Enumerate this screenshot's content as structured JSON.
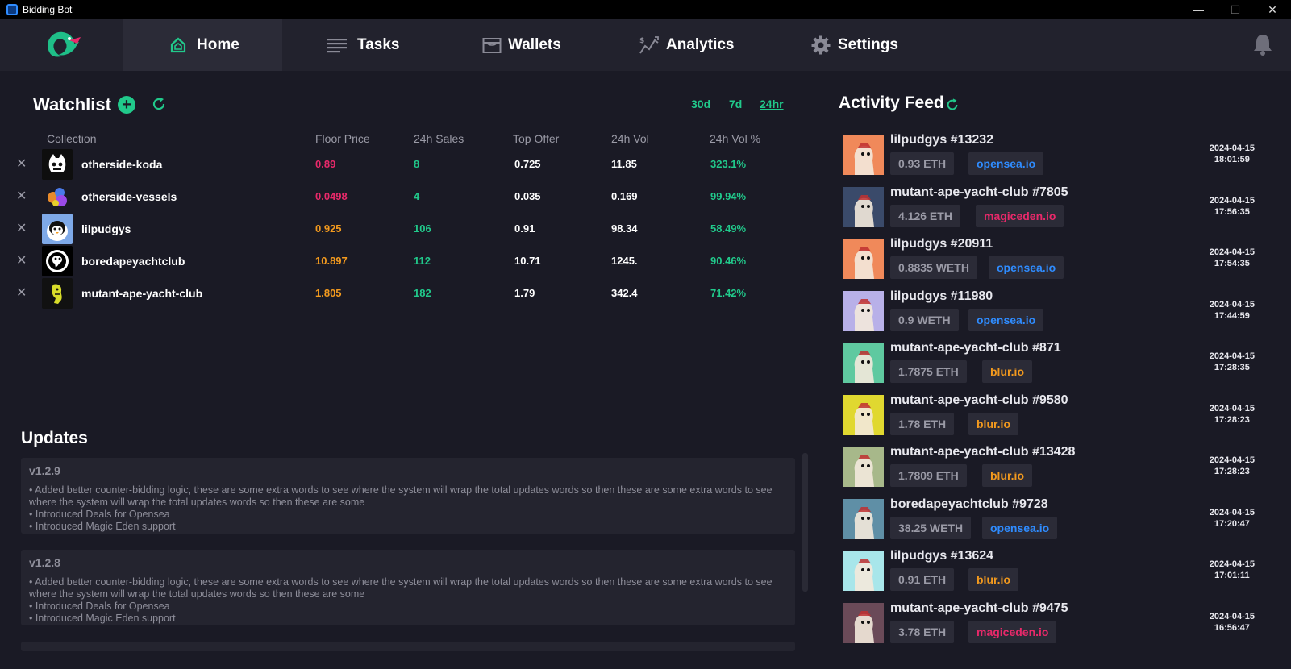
{
  "window": {
    "title": "Bidding Bot",
    "controls": [
      "—",
      "☐",
      "✕"
    ]
  },
  "nav": {
    "items": [
      {
        "label": "Home",
        "icon": "home-icon",
        "active": true
      },
      {
        "label": "Tasks",
        "icon": "list-icon"
      },
      {
        "label": "Wallets",
        "icon": "wallet-icon"
      },
      {
        "label": "Analytics",
        "icon": "analytics-icon"
      },
      {
        "label": "Settings",
        "icon": "gear-icon"
      }
    ],
    "notification_icon": "bell-icon"
  },
  "watchlist": {
    "title": "Watchlist",
    "add_label": "+",
    "ranges": [
      "30d",
      "7d",
      "24hr"
    ],
    "selected_range": "24hr",
    "columns": [
      "Collection",
      "Floor Price",
      "24h Sales",
      "Top Offer",
      "24h Vol",
      "24h Vol %"
    ],
    "remove_label": "✕",
    "rows": [
      {
        "name": "otherside-koda",
        "floor": "0.89",
        "sales": "8",
        "offer": "0.725",
        "vol": "11.85",
        "vol_pct": "323.1%",
        "floor_color": "#e8296a",
        "thumb": "koda"
      },
      {
        "name": "otherside-vessels",
        "floor": "0.0498",
        "sales": "4",
        "offer": "0.035",
        "vol": "0.169",
        "vol_pct": "99.94%",
        "floor_color": "#e8296a",
        "thumb": "vessels"
      },
      {
        "name": "lilpudgys",
        "floor": "0.925",
        "sales": "106",
        "offer": "0.91",
        "vol": "98.34",
        "vol_pct": "58.49%",
        "floor_color": "#f39a1e",
        "thumb": "pudgy"
      },
      {
        "name": "boredapeyachtclub",
        "floor": "10.897",
        "sales": "112",
        "offer": "10.71",
        "vol": "1245.",
        "vol_pct": "90.46%",
        "floor_color": "#f39a1e",
        "thumb": "bayc"
      },
      {
        "name": "mutant-ape-yacht-club",
        "floor": "1.805",
        "sales": "182",
        "offer": "1.79",
        "vol": "342.4",
        "vol_pct": "71.42%",
        "floor_color": "#f39a1e",
        "thumb": "mayc"
      }
    ]
  },
  "updates": {
    "title": "Updates",
    "entries": [
      {
        "version": "v1.2.9",
        "lines": [
          "• Added better counter-bidding logic, these are some extra words to see where the system will wrap the total updates words so then these are some extra words to see",
          "where the system will wrap the total updates words so then these are some",
          "• Introduced Deals for Opensea",
          "• Introduced Magic Eden support"
        ]
      },
      {
        "version": "v1.2.8",
        "lines": [
          "• Added better counter-bidding logic, these are some extra words to see where the system will wrap the total updates words so then these are some extra words to see",
          "where the system will wrap the total updates words so then these are some",
          "• Introduced Deals for Opensea",
          "• Introduced Magic Eden support"
        ]
      }
    ]
  },
  "activity": {
    "title": "Activity Feed",
    "items": [
      {
        "name": "lilpudgys #13232",
        "price": "0.93 ETH",
        "market": "opensea.io",
        "date": "2024-04-15",
        "time": "18:01:59",
        "bg": "#f0895a"
      },
      {
        "name": "mutant-ape-yacht-club #7805",
        "price": "4.126 ETH",
        "market": "magiceden.io",
        "date": "2024-04-15",
        "time": "17:56:35",
        "bg": "#3a4a6a"
      },
      {
        "name": "lilpudgys #20911",
        "price": "0.8835 WETH",
        "market": "opensea.io",
        "date": "2024-04-15",
        "time": "17:54:35",
        "bg": "#f0895a"
      },
      {
        "name": "lilpudgys #11980",
        "price": "0.9 WETH",
        "market": "opensea.io",
        "date": "2024-04-15",
        "time": "17:44:59",
        "bg": "#b8b0e8"
      },
      {
        "name": "mutant-ape-yacht-club #871",
        "price": "1.7875 ETH",
        "market": "blur.io",
        "date": "2024-04-15",
        "time": "17:28:35",
        "bg": "#5fc9a0"
      },
      {
        "name": "mutant-ape-yacht-club #9580",
        "price": "1.78 ETH",
        "market": "blur.io",
        "date": "2024-04-15",
        "time": "17:28:23",
        "bg": "#e0d830"
      },
      {
        "name": "mutant-ape-yacht-club #13428",
        "price": "1.7809 ETH",
        "market": "blur.io",
        "date": "2024-04-15",
        "time": "17:28:23",
        "bg": "#a7b88a"
      },
      {
        "name": "boredapeyachtclub #9728",
        "price": "38.25 WETH",
        "market": "opensea.io",
        "date": "2024-04-15",
        "time": "17:20:47",
        "bg": "#5f8fa6"
      },
      {
        "name": "lilpudgys #13624",
        "price": "0.91 ETH",
        "market": "blur.io",
        "date": "2024-04-15",
        "time": "17:01:11",
        "bg": "#a8e6ea"
      },
      {
        "name": "mutant-ape-yacht-club #9475",
        "price": "3.78 ETH",
        "market": "magiceden.io",
        "date": "2024-04-15",
        "time": "16:56:47",
        "bg": "#6a4a58"
      }
    ]
  },
  "market_colors": {
    "opensea.io": "#2f8cff",
    "magiceden.io": "#e8296a",
    "blur.io": "#f39a1e"
  },
  "colors": {
    "accent": "#21c98b",
    "background": "#1a1a25",
    "panel": "#22222d"
  }
}
